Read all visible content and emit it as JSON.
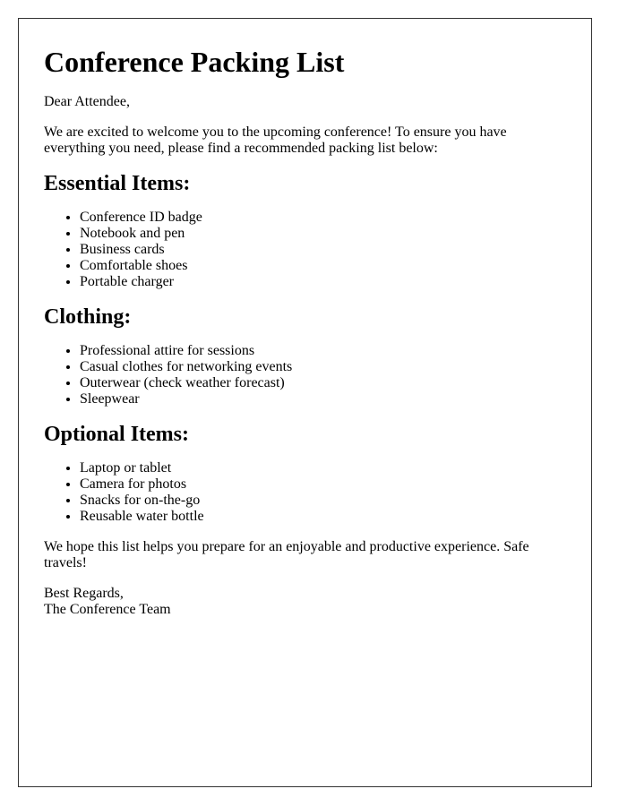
{
  "title": "Conference Packing List",
  "greeting": "Dear Attendee,",
  "intro": "We are excited to welcome you to the upcoming conference! To ensure you have everything you need, please find a recommended packing list below:",
  "sections": [
    {
      "heading": "Essential Items:",
      "items": [
        "Conference ID badge",
        "Notebook and pen",
        "Business cards",
        "Comfortable shoes",
        "Portable charger"
      ]
    },
    {
      "heading": "Clothing:",
      "items": [
        "Professional attire for sessions",
        "Casual clothes for networking events",
        "Outerwear (check weather forecast)",
        "Sleepwear"
      ]
    },
    {
      "heading": "Optional Items:",
      "items": [
        "Laptop or tablet",
        "Camera for photos",
        "Snacks for on-the-go",
        "Reusable water bottle"
      ]
    }
  ],
  "closing": "We hope this list helps you prepare for an enjoyable and productive experience. Safe travels!",
  "signoff": {
    "line1": "Best Regards,",
    "line2": "The Conference Team"
  }
}
